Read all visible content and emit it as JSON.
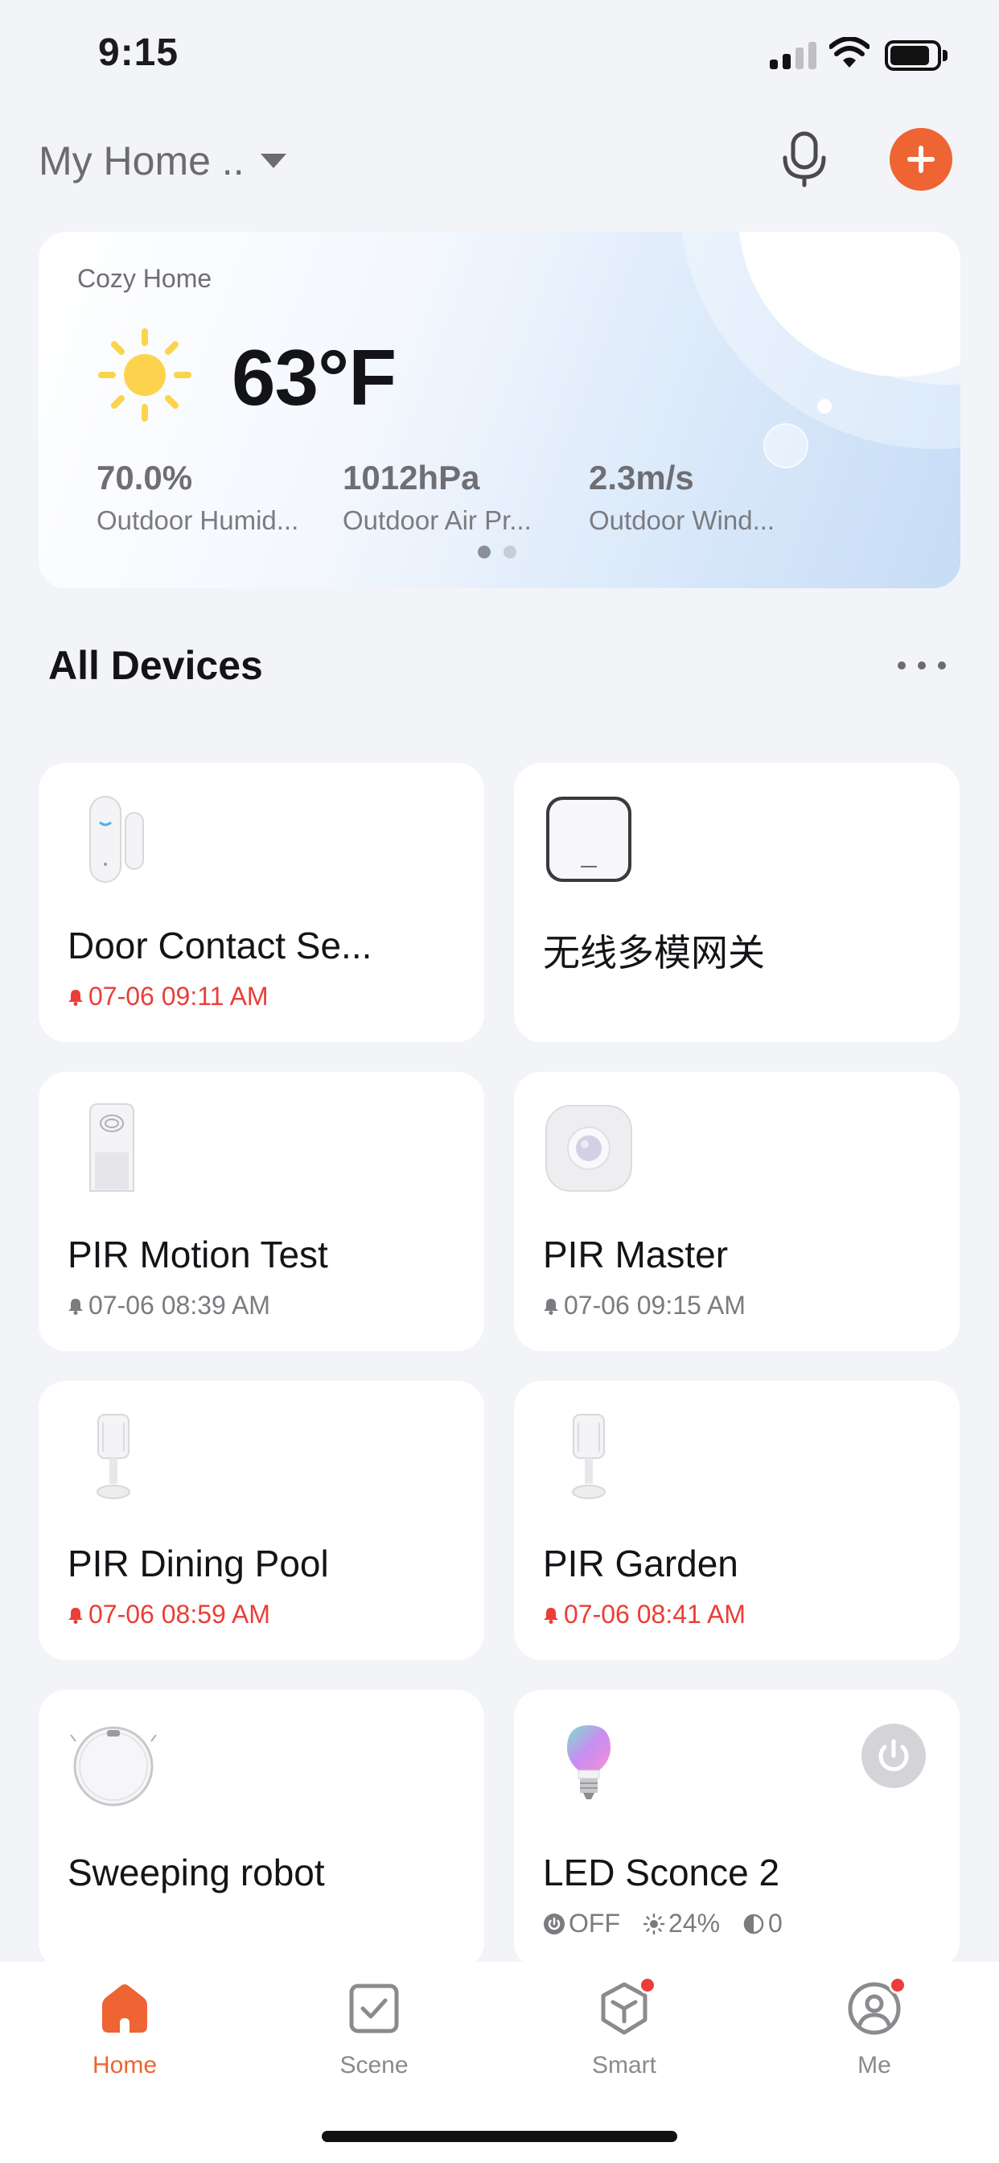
{
  "status_bar": {
    "time": "9:15"
  },
  "header": {
    "home_name": "My Home ..",
    "icons": [
      "microphone-icon",
      "plus-icon"
    ],
    "accent_color": "#ee6433"
  },
  "weather": {
    "place": "Cozy Home",
    "icon": "sun-icon",
    "temperature": "63°F",
    "stats": [
      {
        "value": "70.0%",
        "label": "Outdoor Humid..."
      },
      {
        "value": "1012hPa",
        "label": "Outdoor Air Pr..."
      },
      {
        "value": "2.3m/s",
        "label": "Outdoor Wind..."
      }
    ],
    "pager": {
      "pages": 2,
      "current": 1
    }
  },
  "devices_section": {
    "title": "All Devices"
  },
  "devices": [
    {
      "name": "Door Contact Se...",
      "status": "07-06 09:11 AM",
      "alert": true,
      "icon": "door-contact-sensor-icon"
    },
    {
      "name": "无线多模网关",
      "status": "",
      "alert": false,
      "icon": "gateway-icon"
    },
    {
      "name": "PIR Motion Test",
      "status": "07-06 08:39 AM",
      "alert": false,
      "icon": "pir-sensor-icon"
    },
    {
      "name": "PIR Master",
      "status": "07-06 09:15 AM",
      "alert": false,
      "icon": "pir-round-sensor-icon"
    },
    {
      "name": "PIR Dining Pool",
      "status": "07-06 08:59 AM",
      "alert": true,
      "icon": "pir-stand-sensor-icon"
    },
    {
      "name": "PIR Garden",
      "status": "07-06 08:41 AM",
      "alert": true,
      "icon": "pir-stand-sensor-icon"
    },
    {
      "name": "Sweeping robot",
      "status": "",
      "alert": false,
      "icon": "robot-vacuum-icon"
    },
    {
      "name": "LED Sconce 2",
      "icon": "light-bulb-icon",
      "power_state": "OFF",
      "brightness": "24%",
      "color_temp": "0"
    }
  ],
  "tab_bar": {
    "tabs": [
      {
        "label": "Home",
        "icon": "home-icon",
        "active": true,
        "badge": false
      },
      {
        "label": "Scene",
        "icon": "scene-checkbox-icon",
        "active": false,
        "badge": false
      },
      {
        "label": "Smart",
        "icon": "smart-cube-icon",
        "active": false,
        "badge": true
      },
      {
        "label": "Me",
        "icon": "profile-icon",
        "active": false,
        "badge": true
      }
    ]
  },
  "colors": {
    "alert": "#ea3e37",
    "background": "#f3f4f8",
    "card": "#ffffff"
  }
}
